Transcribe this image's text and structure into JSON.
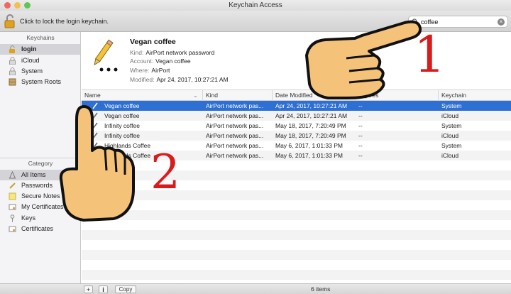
{
  "window": {
    "title": "Keychain Access"
  },
  "toolbar": {
    "lock_text": "Click to lock the login keychain."
  },
  "search": {
    "value": "coffee"
  },
  "sidebar": {
    "keychains_header": "Keychains",
    "keychains": [
      {
        "label": "login",
        "icon": "lock-icon"
      },
      {
        "label": "iCloud",
        "icon": "lock-icon"
      },
      {
        "label": "System",
        "icon": "lock-icon"
      },
      {
        "label": "System Roots",
        "icon": "cabinet-icon"
      }
    ],
    "category_header": "Category",
    "categories": [
      {
        "label": "All Items",
        "icon": "all-items-icon"
      },
      {
        "label": "Passwords",
        "icon": "password-icon"
      },
      {
        "label": "Secure Notes",
        "icon": "note-icon"
      },
      {
        "label": "My Certificates",
        "icon": "certificate-icon"
      },
      {
        "label": "Keys",
        "icon": "key-icon"
      },
      {
        "label": "Certificates",
        "icon": "certificate-icon"
      }
    ]
  },
  "details": {
    "title": "Vegan coffee",
    "kind_label": "Kind:",
    "kind": "AirPort network password",
    "account_label": "Account:",
    "account": "Vegan coffee",
    "where_label": "Where:",
    "where": "AirPort",
    "modified_label": "Modified:",
    "modified": "Apr 24, 2017, 10:27:21 AM"
  },
  "table": {
    "columns": [
      "Name",
      "Kind",
      "Date Modified",
      "Expires",
      "Keychain"
    ],
    "rows": [
      [
        "Vegan coffee",
        "AirPort network pas...",
        "Apr 24, 2017, 10:27:21 AM",
        "--",
        "System"
      ],
      [
        "Vegan coffee",
        "AirPort network pas...",
        "Apr 24, 2017, 10:27:21 AM",
        "--",
        "iCloud"
      ],
      [
        "Infinity coffee",
        "AirPort network pas...",
        "May 18, 2017, 7:20:49 PM",
        "--",
        "System"
      ],
      [
        "Infinity coffee",
        "AirPort network pas...",
        "May 18, 2017, 7:20:49 PM",
        "--",
        "iCloud"
      ],
      [
        "Highlands Coffee",
        "AirPort network pas...",
        "May 6, 2017, 1:01:33 PM",
        "--",
        "System"
      ],
      [
        "Highlands Coffee",
        "AirPort network pas...",
        "May 6, 2017, 1:01:33 PM",
        "--",
        "iCloud"
      ]
    ],
    "selected_row": 0
  },
  "statusbar": {
    "add": "+",
    "info": "i",
    "copy": "Copy",
    "count": "6 items"
  },
  "annotations": {
    "step1": "1",
    "step2": "2"
  },
  "colors": {
    "selection": "#2d6fd3",
    "annotation": "#d81c1c",
    "hand": "#f5c27a"
  }
}
